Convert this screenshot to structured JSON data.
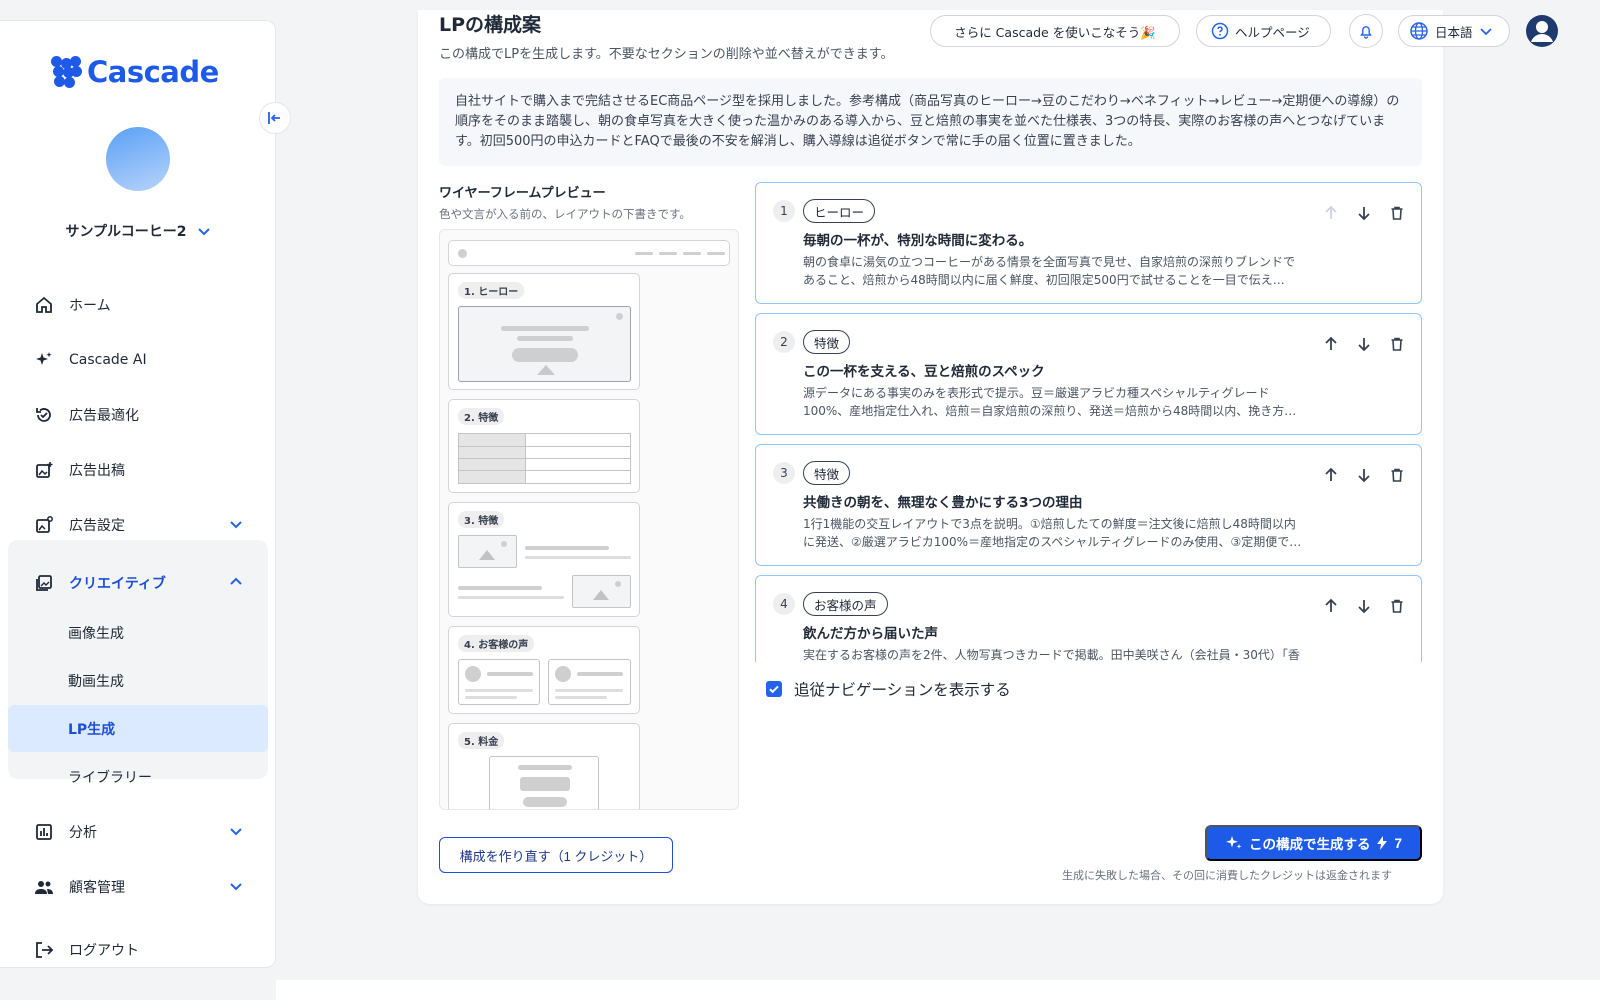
{
  "brand": {
    "name": "Cascade",
    "accent": "#1e5ae8"
  },
  "account": {
    "name": "サンプルコーヒー2"
  },
  "nav": {
    "home": "ホーム",
    "ai": "Cascade AI",
    "ad_opt": "広告最適化",
    "ad_post": "広告出稿",
    "ad_settings": "広告設定",
    "creative": "クリエイティブ",
    "image_gen": "画像生成",
    "video_gen": "動画生成",
    "lp_gen": "LP生成",
    "library": "ライブラリー",
    "analytics": "分析",
    "customers": "顧客管理",
    "logout": "ログアウト"
  },
  "topbar": {
    "promo": "さらに Cascade を使いこなそう🎉",
    "help": "ヘルプページ",
    "language": "日本語"
  },
  "page": {
    "title": "LPの構成案",
    "subtitle": "この構成でLPを生成します。不要なセクションの削除や並べ替えができます。",
    "summary": "自社サイトで購入まで完結させるEC商品ページ型を採用しました。参考構成（商品写真のヒーロー→豆のこだわり→ベネフィット→レビュー→定期便への導線）の順序をそのまま踏襲し、朝の食卓写真を大きく使った温かみのある導入から、豆と焙煎の事実を並べた仕様表、3つの特長、実際のお客様の声へとつなげています。初回500円の申込カードとFAQで最後の不安を解消し、購入導線は追従ボタンで常に手の届く位置に置きました。"
  },
  "wireframe": {
    "title": "ワイヤーフレームプレビュー",
    "subtitle": "色や文言が入る前の、レイアウトの下書きです。",
    "tags": [
      "1. ヒーロー",
      "2. 特徴",
      "3. 特徴",
      "4. お客様の声",
      "5. 料金"
    ]
  },
  "sections": [
    {
      "num": "1",
      "tag": "ヒーロー",
      "title": "毎朝の一杯が、特別な時間に変わる。",
      "desc": "朝の食卓に湯気の立つコーヒーがある情景を全面写真で見せ、自家焙煎の深煎りブレンドであること、焙煎から48時間以内に届く鮮度、初回限定500円で試せることを一目で伝える。…"
    },
    {
      "num": "2",
      "tag": "特徴",
      "title": "この一杯を支える、豆と焙煎のスペック",
      "desc": "源データにある事実のみを表形式で提示。豆＝厳選アラビカ種スペシャルティグレード100%、産地指定仕入れ、焙煎＝自家焙煎の深煎り、発送＝焙煎から48時間以内、挽き方＝…"
    },
    {
      "num": "3",
      "tag": "特徴",
      "title": "共働きの朝を、無理なく豊かにする3つの理由",
      "desc": "1行1機能の交互レイアウトで3点を説明。①焙煎したての鮮度＝注文後に焙煎し48時間以内に発送、②厳選アラビカ100%＝産地指定のスペシャルティグレードのみ使用、③定期便で…"
    },
    {
      "num": "4",
      "tag": "お客様の声",
      "title": "飲んだ方から届いた声",
      "desc": "実在するお客様の声を2件、人物写真つきカードで掲載。田中美咲さん（会社員・30代）「香"
    }
  ],
  "sticky_nav": {
    "label": "追従ナビゲーションを表示する",
    "checked": true
  },
  "actions": {
    "regen": "構成を作り直す（1 クレジット）",
    "generate": "この構成で生成する",
    "credits": "7",
    "note": "生成に失敗した場合、その回に消費したクレジットは返金されます"
  }
}
